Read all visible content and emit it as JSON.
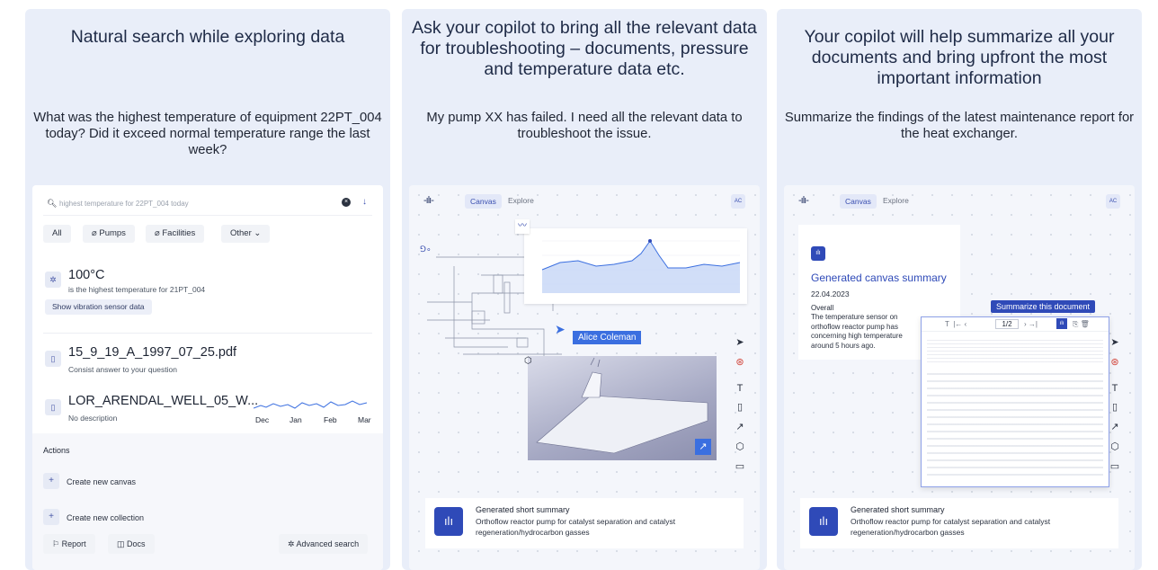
{
  "panels": [
    {
      "title": "Natural search while exploring data",
      "prompt": "What was the highest temperature of equipment 22PT_004 today? Did it exceed normal temperature range the last week?",
      "search_query": "highest temperature for 22PT_004 today",
      "filters": [
        "All",
        "Pumps",
        "Facilities",
        "Other"
      ],
      "result": {
        "value": "100°C",
        "caption": "is the highest temperature for 21PT_004",
        "action": "Show vibration sensor data"
      },
      "docs": [
        {
          "name": "15_9_19_A_1997_07_25.pdf",
          "desc": "Consist answer to your question"
        },
        {
          "name": "LOR_ARENDAL_WELL_05_W...",
          "desc": "No description"
        }
      ],
      "months": [
        "Dec",
        "Jan",
        "Feb",
        "Mar"
      ],
      "actions_title": "Actions",
      "actions": [
        "Create new canvas",
        "Create new collection"
      ],
      "footer": {
        "report": "Report",
        "docs": "Docs",
        "advanced": "Advanced search"
      }
    },
    {
      "title": "Ask your copilot to bring all the relevant data for troubleshooting – documents, pressure and temperature data etc.",
      "prompt": "My pump XX has failed. I need all the relevant data to troubleshoot the issue.",
      "tabs": {
        "canvas": "Canvas",
        "explore": "Explore"
      },
      "avatar": "AC",
      "cursor_name": "Alice Coleman",
      "summary_title": "Generated short summary",
      "summary_text": "Orthoflow reactor pump for catalyst separation and catalyst regeneration/hydrocarbon gasses"
    },
    {
      "title": "Your copilot will help summarize all your documents and bring upfront the most important information",
      "prompt": "Summarize the findings of the latest maintenance report for the heat exchanger.",
      "tabs": {
        "canvas": "Canvas",
        "explore": "Explore"
      },
      "avatar": "AC",
      "gen_title": "Generated canvas summary",
      "gen_date": "22.04.2023",
      "gen_overall": "Overall",
      "gen_text": "The temperature sensor on orthoflow reactor pump has concerning high temperature around 5 hours ago.",
      "tooltip": "Summarize this document",
      "page": "1/2",
      "summary_title": "Generated short summary",
      "summary_text": "Orthoflow reactor pump for catalyst separation and catalyst regeneration/hydrocarbon gasses"
    }
  ],
  "colors": {
    "panel_bg": "#e9eef9",
    "accent": "#2f4ab8",
    "chart_line": "#3b6fe0"
  }
}
